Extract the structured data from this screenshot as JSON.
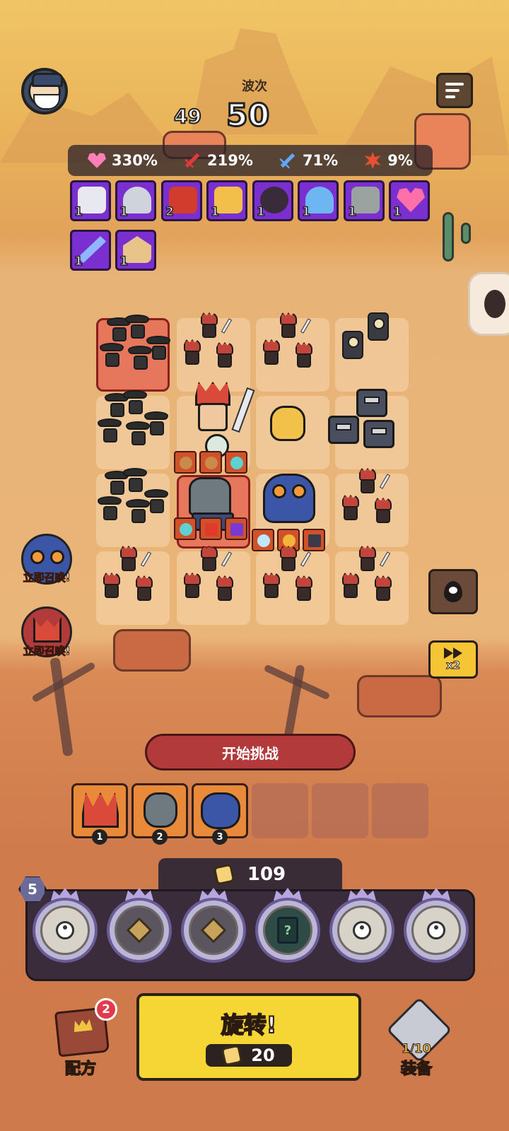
{
  "header": {
    "wave_label": "波次",
    "wave_prev": "49",
    "wave_current": "50",
    "avatar_icon": "commander-avatar-icon",
    "menu_icon": "menu-icon"
  },
  "stats": [
    {
      "icon": "heart-icon",
      "value": "330%"
    },
    {
      "icon": "attack-sword-icon",
      "value": "219%"
    },
    {
      "icon": "attack-speed-icon",
      "value": "71%"
    },
    {
      "icon": "critical-icon",
      "value": "9%"
    }
  ],
  "buffs": [
    {
      "icon": "soldier-crowd-icon",
      "count": "1",
      "color": "#e8e8f0"
    },
    {
      "icon": "supply-drop-icon",
      "count": "1",
      "color": "#cfd4dc"
    },
    {
      "icon": "blood-splash-icon",
      "count": "2",
      "color": "#d23c2c"
    },
    {
      "icon": "balance-scale-icon",
      "count": "1",
      "color": "#f2c04a"
    },
    {
      "icon": "bomb-icon",
      "count": "1",
      "color": "#3a2b3a"
    },
    {
      "icon": "paratrooper-icon",
      "count": "1",
      "color": "#6db6f2"
    },
    {
      "icon": "graves-icon",
      "count": "1",
      "color": "#9aa3a0"
    },
    {
      "icon": "heart-boost-icon",
      "count": "1",
      "color": "#ff6fa8"
    },
    {
      "icon": "magic-wand-icon",
      "count": "1",
      "color": "#8fb6ff"
    },
    {
      "icon": "bank-building-icon",
      "count": "1",
      "color": "#e8c48a"
    }
  ],
  "board_items": {
    "hero_top": [
      "drum-item-icon",
      "drum-item-icon",
      "spirit-flame-item-icon"
    ],
    "hero_bottom": [
      "spirit-flame-item-icon",
      "blade-item-icon",
      "scythe-item-icon"
    ],
    "owl_bottom": [
      "crystal-heart-item-icon",
      "spartan-helmet-item-icon",
      "reaper-scythe-item-icon"
    ]
  },
  "summons": [
    {
      "icon": "owl-hero-icon",
      "label": "立即召唤!"
    },
    {
      "icon": "demon-hero-icon",
      "label": "立即召唤!"
    }
  ],
  "side_buttons": {
    "skull_icon": "skull-pin-icon",
    "speed_icon": "fast-forward-icon",
    "speed_label": "x2"
  },
  "start_button": "开始挑战",
  "queue": [
    {
      "icon": "red-hair-warrior-icon",
      "num": "1"
    },
    {
      "icon": "robot-knight-icon",
      "num": "2"
    },
    {
      "icon": "owl-mage-icon",
      "num": "3"
    }
  ],
  "coins": "109",
  "level": "5",
  "slots": [
    "person-icon",
    "diamond-rune-icon",
    "diamond-rune-icon",
    "mystery-card-icon",
    "person-icon",
    "person-icon"
  ],
  "spin": {
    "label": "旋转!",
    "cost": "20"
  },
  "bottom_nav": {
    "recipe_label": "配方",
    "recipe_badge": "2",
    "equip_label": "装备",
    "equip_count": "1/10"
  },
  "colors": {
    "buff_bg": "#7b2fd1",
    "spin_button": "#f6d635",
    "start_button": "#b23a3a",
    "item_chip": "#d0522a"
  }
}
